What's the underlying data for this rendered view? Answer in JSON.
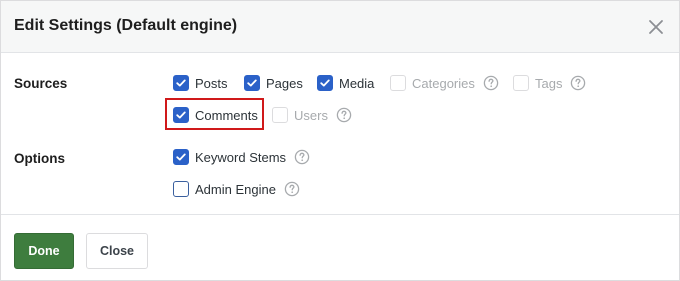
{
  "modal": {
    "title": "Edit Settings (Default engine)",
    "close_icon": "close-icon"
  },
  "sources": {
    "label": "Sources",
    "items": [
      {
        "label": "Posts",
        "checked": true,
        "disabled": false
      },
      {
        "label": "Pages",
        "checked": true,
        "disabled": false
      },
      {
        "label": "Media",
        "checked": true,
        "disabled": false
      },
      {
        "label": "Categories",
        "checked": false,
        "disabled": true
      },
      {
        "label": "Tags",
        "checked": false,
        "disabled": true
      },
      {
        "label": "Comments",
        "checked": true,
        "disabled": false
      },
      {
        "label": "Users",
        "checked": false,
        "disabled": true
      }
    ]
  },
  "options": {
    "label": "Options",
    "items": [
      {
        "label": "Keyword Stems",
        "checked": true
      },
      {
        "label": "Admin Engine",
        "checked": false
      }
    ]
  },
  "footer": {
    "done_label": "Done",
    "close_label": "Close"
  },
  "colors": {
    "accent": "#2b61c8",
    "primary_button": "#3e7d3e",
    "highlight": "#d0191a"
  },
  "icons": {
    "help": "help-circle-icon",
    "check": "checkmark-icon"
  }
}
